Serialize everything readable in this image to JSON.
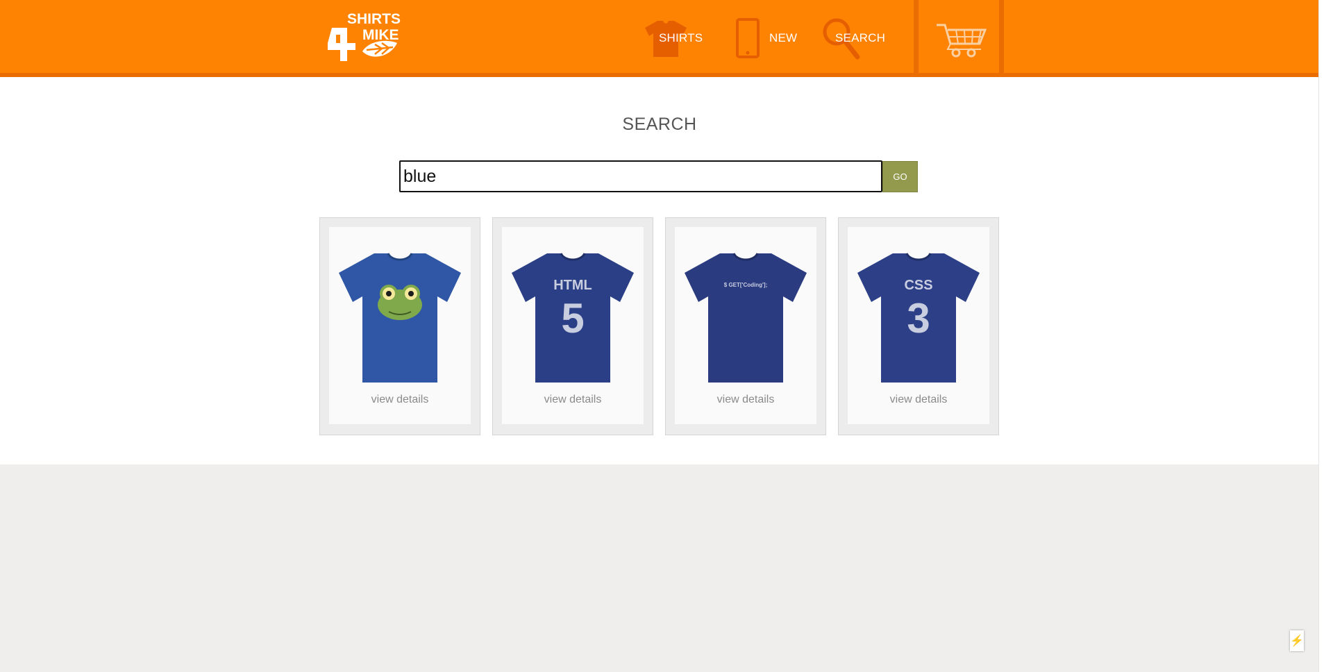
{
  "header": {
    "logo_text": "SHIRTS 4 MIKE",
    "nav": [
      {
        "label": "SHIRTS",
        "icon": "shirt-icon"
      },
      {
        "label": "NEW",
        "icon": "phone-icon"
      },
      {
        "label": "SEARCH",
        "icon": "search-icon"
      }
    ],
    "cart_icon": "cart-icon",
    "brand_color": "#fe8303"
  },
  "main": {
    "title": "SEARCH",
    "search": {
      "value": "blue",
      "button_label": "GO"
    },
    "products": [
      {
        "link_label": "view details",
        "print": "frog-face",
        "shirt_color": "#2f57a6"
      },
      {
        "link_label": "view details",
        "print": "HTML 5",
        "shirt_color": "#2a3f86"
      },
      {
        "link_label": "view details",
        "print": "$ GET['Coding'];",
        "shirt_color": "#2a3b80"
      },
      {
        "link_label": "view details",
        "print": "CSS 3",
        "shirt_color": "#2c3f87"
      }
    ]
  },
  "widget": {
    "icon": "lightning-icon",
    "glyph": "⚡"
  }
}
